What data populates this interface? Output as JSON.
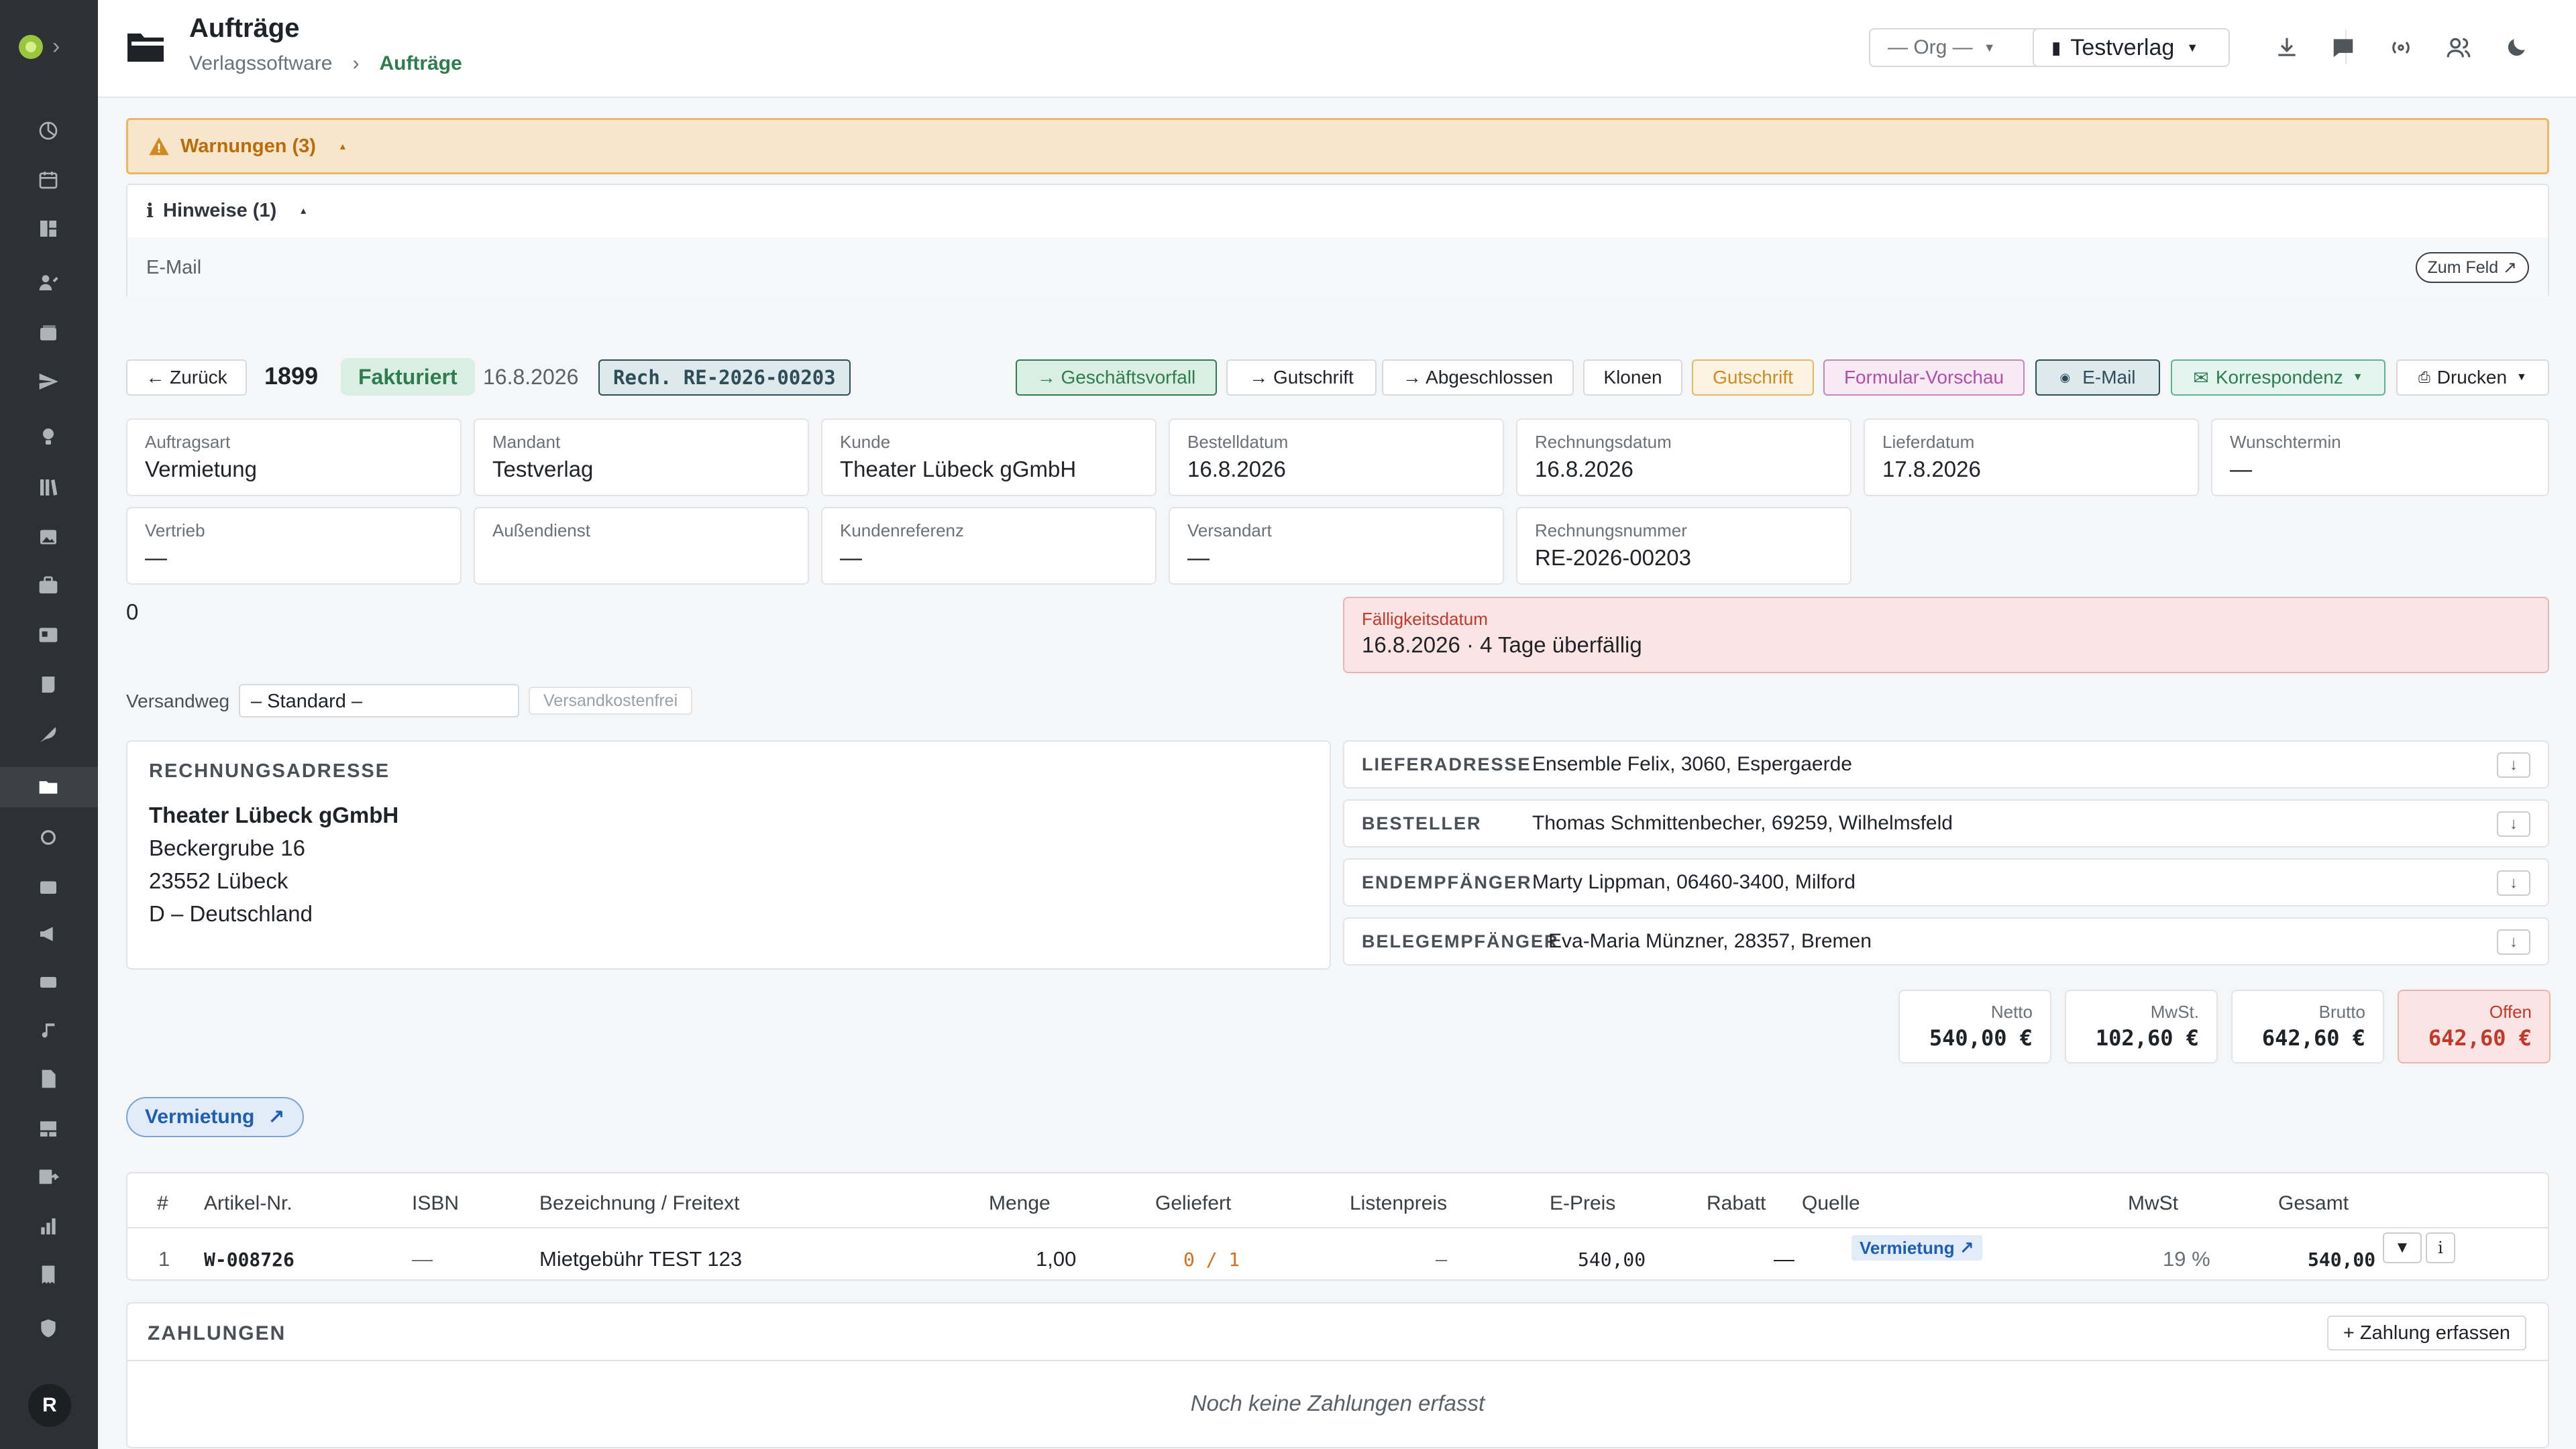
{
  "header": {
    "title": "Aufträge",
    "breadcrumb": [
      "Verlagssoftware",
      "Aufträge"
    ],
    "org_select": "— Org —",
    "tenant_select": "Testverlag"
  },
  "warnings": {
    "label": "Warnungen (3)"
  },
  "hints": {
    "label": "Hinweise (1)",
    "item": "E-Mail",
    "goto": "Zum Feld ↗"
  },
  "toolbar": {
    "back": "← Zurück",
    "order_no": "1899",
    "status": "Fakturiert",
    "date": "16.8.2026",
    "invoice_ref": "Rech. RE-2026-00203",
    "actions": {
      "business_case": "→ Geschäftsvorfall",
      "credit_note": "→ Gutschrift",
      "completed": "→ Abgeschlossen",
      "clone": "Klonen",
      "gutschrift": "Gutschrift",
      "form_preview": "Formular-Vorschau",
      "email": "E-Mail",
      "correspondence": "Korrespondenz",
      "print": "Drucken"
    }
  },
  "fields": [
    {
      "label": "Auftragsart",
      "value": "Vermietung"
    },
    {
      "label": "Mandant",
      "value": "Testverlag"
    },
    {
      "label": "Kunde",
      "value": "Theater Lübeck gGmbH"
    },
    {
      "label": "Bestelldatum",
      "value": "16.8.2026"
    },
    {
      "label": "Rechnungsdatum",
      "value": "16.8.2026"
    },
    {
      "label": "Lieferdatum",
      "value": "17.8.2026"
    },
    {
      "label": "Wunschtermin",
      "value": "—"
    },
    {
      "label": "Vertrieb",
      "value": "—"
    },
    {
      "label": "Außendienst",
      "value": ""
    },
    {
      "label": "Kundenreferenz",
      "value": "—"
    },
    {
      "label": "Versandart",
      "value": "—"
    },
    {
      "label": "Rechnungsnummer",
      "value": "RE-2026-00203"
    }
  ],
  "zero_value": "0",
  "due": {
    "label": "Fälligkeitsdatum",
    "value": "16.8.2026 · 4 Tage überfällig"
  },
  "shipping": {
    "label": "Versandweg",
    "value": "– Standard –",
    "free": "Versandkostenfrei"
  },
  "billing_address": {
    "heading": "RECHNUNGSADRESSE",
    "name": "Theater Lübeck gGmbH",
    "street": "Beckergrube 16",
    "city": "23552 Lübeck",
    "country": "D – Deutschland"
  },
  "addresses": [
    {
      "key": "LIEFERADRESSE",
      "value": "Ensemble Felix, 3060, Espergaerde"
    },
    {
      "key": "BESTELLER",
      "value": "Thomas Schmittenbecher, 69259, Wilhelmsfeld"
    },
    {
      "key": "ENDEMPFÄNGER",
      "value": "Marty Lippman, 06460-3400, Milford"
    },
    {
      "key": "BELEGEMPFÄNGER",
      "value": "Eva-Maria Münzner, 28357, Bremen"
    }
  ],
  "totals": {
    "net_label": "Netto",
    "net": "540,00 €",
    "vat_label": "MwSt.",
    "vat": "102,60 €",
    "gross_label": "Brutto",
    "gross": "642,60 €",
    "open_label": "Offen",
    "open": "642,60 €"
  },
  "order_type_pill": "Vermietung",
  "table": {
    "headers": [
      "#",
      "Artikel-Nr.",
      "ISBN",
      "Bezeichnung / Freitext",
      "Menge",
      "Geliefert",
      "Listenpreis",
      "E-Preis",
      "Rabatt",
      "Quelle",
      "MwSt",
      "Gesamt"
    ],
    "row": {
      "pos": "1",
      "article": "W-008726",
      "isbn": "—",
      "desc": "Mietgebühr TEST 123",
      "qty": "1,00",
      "delivered": "0 / 1",
      "list_price": "–",
      "unit_price": "540,00",
      "discount": "—",
      "source": "Vermietung ↗",
      "vat": "19 %",
      "total": "540,00"
    }
  },
  "payments": {
    "heading": "ZAHLUNGEN",
    "add": "+ Zahlung erfassen",
    "empty": "Noch keine Zahlungen erfasst"
  },
  "user": {
    "initial": "R"
  },
  "colors": {
    "accent": "#2e7d4f",
    "warning": "#e8b867",
    "danger": "#c0392b",
    "sidebar": "#2d3034"
  }
}
